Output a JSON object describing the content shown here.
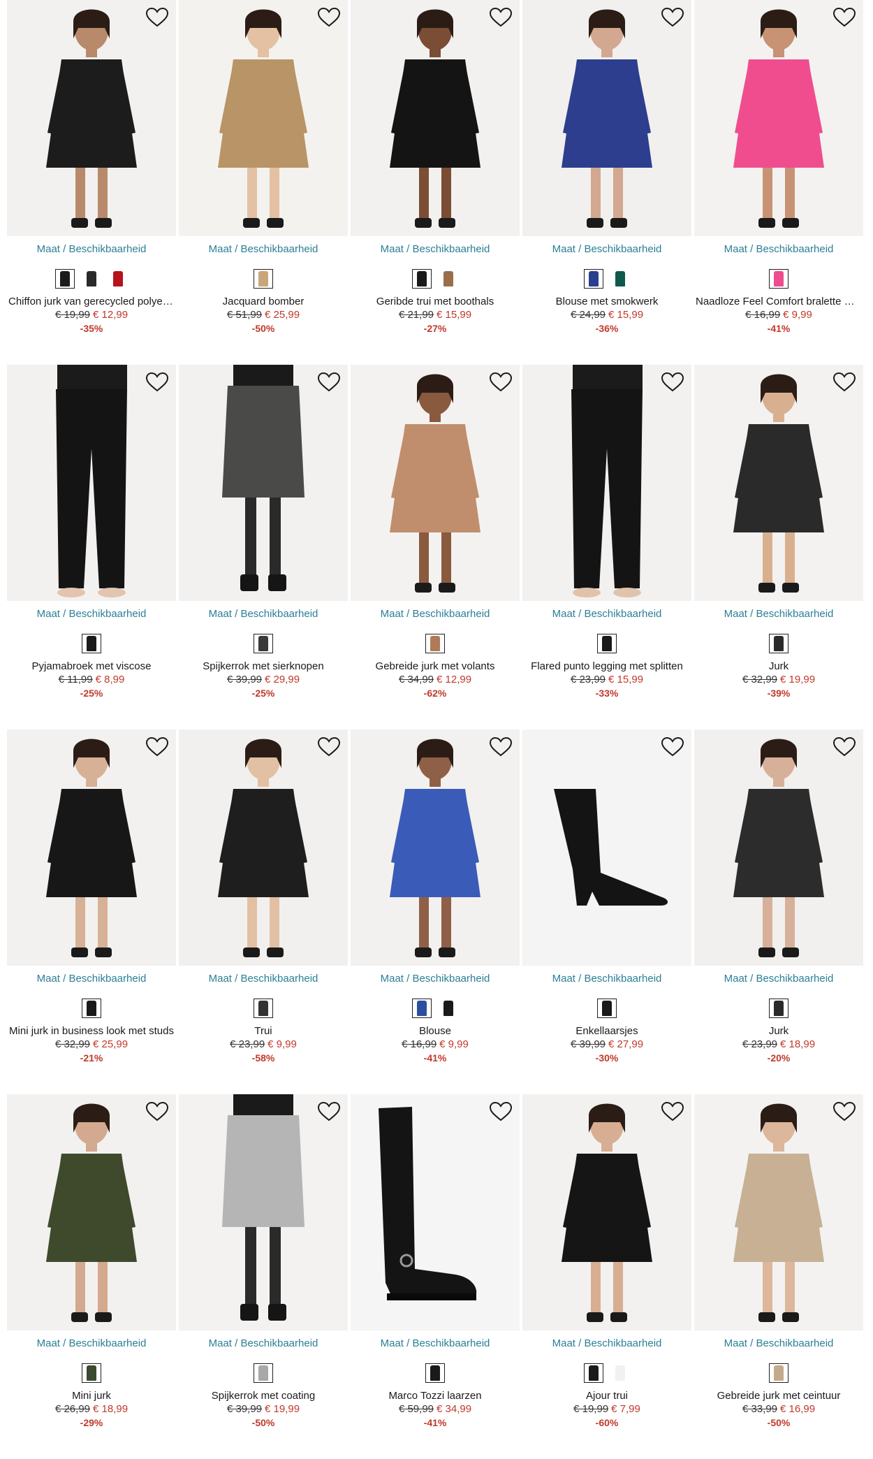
{
  "availability_label": "Maat / Beschikbaarheid",
  "products": [
    {
      "title": "Chiffon jurk van gerecycled polyester",
      "old_price": "€ 19,99",
      "new_price": "€ 12,99",
      "discount": "-35%",
      "image": "woman-black-chiffon-dress",
      "colors": [
        "#1b1b1b",
        "#2a2a2a",
        "#b8121a"
      ],
      "bg": "#f2f1ef",
      "garment": "#1c1c1c",
      "skin": "#b88a6b"
    },
    {
      "title": "Jacquard bomber",
      "old_price": "€ 51,99",
      "new_price": "€ 25,99",
      "discount": "-50%",
      "image": "woman-leopard-bomber",
      "colors": [
        "#c9a679"
      ],
      "bg": "#f3f2ef",
      "garment": "#b89466",
      "skin": "#e4c1a3"
    },
    {
      "title": "Geribde trui met boothals",
      "old_price": "€ 21,99",
      "new_price": "€ 15,99",
      "discount": "-27%",
      "image": "woman-black-ribbed-sweater",
      "colors": [
        "#1a1a1a",
        "#9a6e4a"
      ],
      "bg": "#f2f1ef",
      "garment": "#141414",
      "skin": "#7a4d34"
    },
    {
      "title": "Blouse met smokwerk",
      "old_price": "€ 24,99",
      "new_price": "€ 15,99",
      "discount": "-36%",
      "image": "woman-blue-print-blouse",
      "colors": [
        "#2b3f8f",
        "#0d5a4c"
      ],
      "bg": "#f1f0ee",
      "garment": "#2d3e8e",
      "skin": "#d2a890"
    },
    {
      "title": "Naadloze Feel Comfort bralette met kant",
      "old_price": "€ 16,99",
      "new_price": "€ 9,99",
      "discount": "-41%",
      "image": "woman-pink-bralette",
      "colors": [
        "#ef4c8d"
      ],
      "bg": "#f3f2f0",
      "garment": "#f04d8f",
      "skin": "#c89274"
    },
    {
      "title": "Pyjamabroek met viscose",
      "old_price": "€ 11,99",
      "new_price": "€ 8,99",
      "discount": "-25%",
      "image": "black-pyjama-trousers",
      "colors": [
        "#1a1a1a"
      ],
      "bg": "#f2f1ef",
      "garment": "#141414",
      "skin": "#e3c4ae"
    },
    {
      "title": "Spijkerrok met sierknopen",
      "old_price": "€ 39,99",
      "new_price": "€ 29,99",
      "discount": "-25%",
      "image": "grey-denim-skirt",
      "colors": [
        "#3a3a3a"
      ],
      "bg": "#f2f1ef",
      "garment": "#4a4a48",
      "skin": "#d9b49a"
    },
    {
      "title": "Gebreide jurk met volants",
      "old_price": "€ 34,99",
      "new_price": "€ 12,99",
      "discount": "-62%",
      "image": "woman-camel-knit-dress",
      "colors": [
        "#b07a56"
      ],
      "bg": "#f3f2f0",
      "garment": "#c08e6c",
      "skin": "#8a5a3e"
    },
    {
      "title": "Flared punto legging met splitten",
      "old_price": "€ 23,99",
      "new_price": "€ 15,99",
      "discount": "-33%",
      "image": "black-flared-leggings",
      "colors": [
        "#1a1a1a"
      ],
      "bg": "#f2f1ef",
      "garment": "#141414",
      "skin": "#e1c3ab"
    },
    {
      "title": "Jurk",
      "old_price": "€ 32,99",
      "new_price": "€ 19,99",
      "discount": "-39%",
      "image": "woman-black-white-print-dress",
      "colors": [
        "#2b2b2b"
      ],
      "bg": "#f3f2f0",
      "garment": "#2a2a2a",
      "skin": "#d9b08f"
    },
    {
      "title": "Mini jurk in business look met studs",
      "old_price": "€ 32,99",
      "new_price": "€ 25,99",
      "discount": "-21%",
      "image": "woman-black-blazer-dress",
      "colors": [
        "#1a1a1a"
      ],
      "bg": "#f2f1ef",
      "garment": "#171717",
      "skin": "#d7b196"
    },
    {
      "title": "Trui",
      "old_price": "€ 23,99",
      "new_price": "€ 9,99",
      "discount": "-58%",
      "image": "woman-striped-sweater",
      "colors": [
        "#333333"
      ],
      "bg": "#f1f0ee",
      "garment": "#1e1e1e",
      "skin": "#e2c0a3"
    },
    {
      "title": "Blouse",
      "old_price": "€ 16,99",
      "new_price": "€ 9,99",
      "discount": "-41%",
      "image": "woman-blue-wrap-blouse",
      "colors": [
        "#2c4fa0",
        "#1a1a1a"
      ],
      "bg": "#f2f1ef",
      "garment": "#3a5bb8",
      "skin": "#8f6047"
    },
    {
      "title": "Enkellaarsjes",
      "old_price": "€ 39,99",
      "new_price": "€ 27,99",
      "discount": "-30%",
      "image": "black-ankle-boot",
      "colors": [
        "#1a1a1a"
      ],
      "bg": "#f4f4f4",
      "garment": "#141414",
      "skin": "#141414"
    },
    {
      "title": "Jurk",
      "old_price": "€ 23,99",
      "new_price": "€ 18,99",
      "discount": "-20%",
      "image": "woman-floral-dress",
      "colors": [
        "#2a2a2a"
      ],
      "bg": "#f1f0ee",
      "garment": "#2c2c2c",
      "skin": "#d7b09a"
    },
    {
      "title": "Mini jurk",
      "old_price": "€ 26,99",
      "new_price": "€ 18,99",
      "discount": "-29%",
      "image": "woman-green-print-dress",
      "colors": [
        "#3b4a30"
      ],
      "bg": "#f2f1ef",
      "garment": "#3f4a2c",
      "skin": "#d3a98f"
    },
    {
      "title": "Spijkerrok met coating",
      "old_price": "€ 39,99",
      "new_price": "€ 19,99",
      "discount": "-50%",
      "image": "silver-coated-denim-skirt",
      "colors": [
        "#a8a8a8"
      ],
      "bg": "#f3f2f0",
      "garment": "#b5b5b5",
      "skin": "#e3c6ad"
    },
    {
      "title": "Marco Tozzi laarzen",
      "old_price": "€ 59,99",
      "new_price": "€ 34,99",
      "discount": "-41%",
      "image": "black-knee-boot",
      "colors": [
        "#1a1a1a"
      ],
      "bg": "#f5f5f5",
      "garment": "#141414",
      "skin": "#141414"
    },
    {
      "title": "Ajour trui",
      "old_price": "€ 19,99",
      "new_price": "€ 7,99",
      "discount": "-60%",
      "image": "woman-black-openknit-sweater",
      "colors": [
        "#1a1a1a",
        "#f1f1f1"
      ],
      "bg": "#f2f1ef",
      "garment": "#151515",
      "skin": "#d7ae92"
    },
    {
      "title": "Gebreide jurk met ceintuur",
      "old_price": "€ 33,99",
      "new_price": "€ 16,99",
      "discount": "-50%",
      "image": "woman-beige-knit-dress",
      "colors": [
        "#c4ab8c"
      ],
      "bg": "#f3f2f0",
      "garment": "#c7b093",
      "skin": "#dcb79c"
    }
  ]
}
